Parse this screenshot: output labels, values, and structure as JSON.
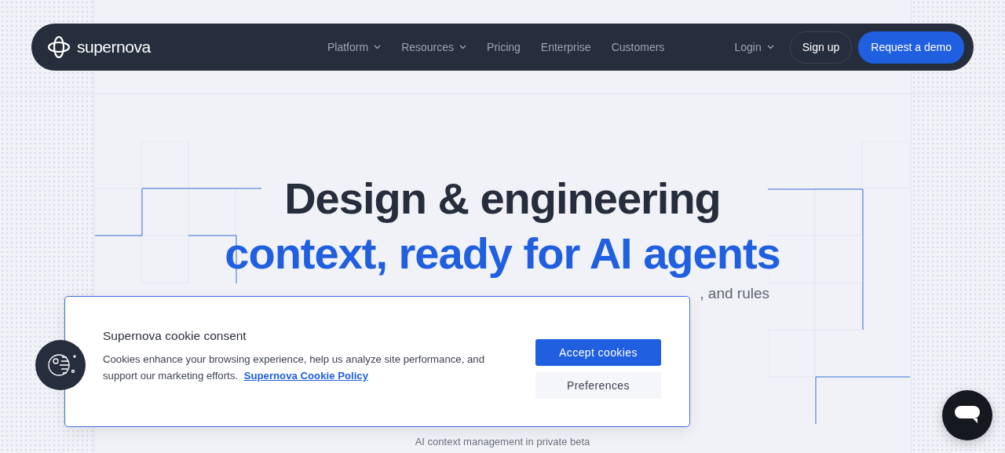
{
  "navbar": {
    "logo": "supernova",
    "links": [
      {
        "label": "Platform",
        "dropdown": true
      },
      {
        "label": "Resources",
        "dropdown": true
      },
      {
        "label": "Pricing",
        "dropdown": false
      },
      {
        "label": "Enterprise",
        "dropdown": false
      },
      {
        "label": "Customers",
        "dropdown": false
      }
    ],
    "login": {
      "label": "Login",
      "dropdown": true
    },
    "buttons": [
      {
        "label": "Sign up",
        "kind": "outline"
      },
      {
        "label": "Request a demo",
        "kind": "primary"
      }
    ]
  },
  "hero": {
    "title_line_1": "Design & engineering",
    "title_line_2": "context, ready for AI agents",
    "subtitle_fragment": ", and rules",
    "note": "AI context management in private beta"
  },
  "cookie_consent": {
    "title": "Supernova cookie consent",
    "text": "Cookies enhance your browsing experience, help us analyze site performance, and support our marketing efforts.",
    "link": "Supernova Cookie Policy",
    "buttons": [
      {
        "label": "Accept cookies",
        "kind": "primary"
      },
      {
        "label": "Preferences",
        "kind": "secondary"
      }
    ]
  }
}
